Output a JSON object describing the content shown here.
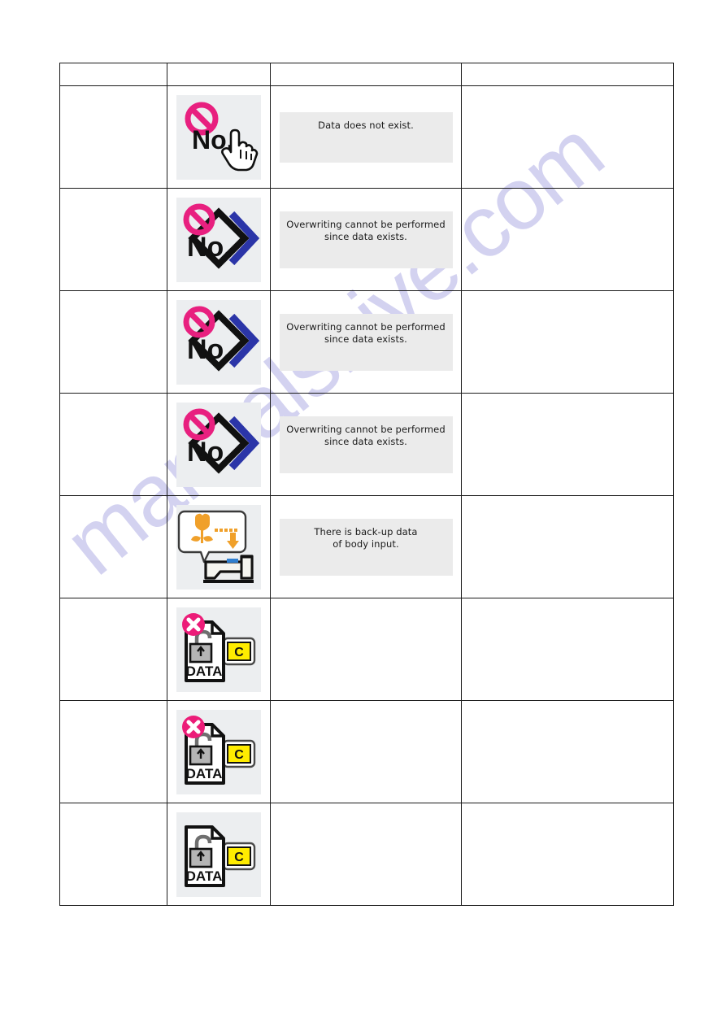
{
  "page": {
    "watermark": "manualshive.com",
    "background_color": "#ffffff",
    "watermark_color": "#b9b7e8"
  },
  "table": {
    "border_color": "#1b1b1b",
    "icon_tile_color": "#eceef0",
    "message_panel_color": "#ebebeb",
    "header": {
      "columns": [
        "",
        "",
        "",
        ""
      ]
    },
    "rows": [
      {
        "code": "",
        "icon_name": "no-data-hand-pointer-icon",
        "icon_description": "Pink prohibition circle over the text No. with a pointing hand cursor",
        "message": "Data does not exist.",
        "description": ""
      },
      {
        "code": "",
        "icon_name": "no-overwrite-diamond-icon",
        "icon_description": "Pink prohibition circle over the text No. with black diamond and blue chevron",
        "message": "Overwriting cannot be performed\nsince data exists.",
        "description": ""
      },
      {
        "code": "",
        "icon_name": "no-overwrite-diamond-icon",
        "icon_description": "Pink prohibition circle over the text No. with black diamond and blue chevron",
        "message": "Overwriting cannot be performed\nsince data exists.",
        "description": ""
      },
      {
        "code": "",
        "icon_name": "no-overwrite-diamond-icon",
        "icon_description": "Pink prohibition circle over the text No. with black diamond and blue chevron",
        "message": "Overwriting cannot be performed\nsince data exists.",
        "description": ""
      },
      {
        "code": "",
        "icon_name": "sewing-machine-backup-data-icon",
        "icon_description": "Sewing machine with speech balloon containing orange tulip pattern and download arrow",
        "message": "There is back-up data\nof body input.",
        "description": ""
      },
      {
        "code": "",
        "icon_name": "data-lock-media-error-icon",
        "icon_description": "DATA file with open padlock and pink X badge, yellow C memory card",
        "message": "",
        "description": ""
      },
      {
        "code": "",
        "icon_name": "data-lock-media-error-icon",
        "icon_description": "DATA file with open padlock and pink X badge, yellow C memory card",
        "message": "",
        "description": ""
      },
      {
        "code": "",
        "icon_name": "data-lock-media-icon",
        "icon_description": "DATA file with open padlock and yellow C memory card",
        "message": "",
        "description": ""
      }
    ]
  },
  "icon_labels": {
    "no_text": "No.",
    "data_text": "DATA",
    "card_letter": "C"
  },
  "colors": {
    "prohibition_pink": "#e8207f",
    "badge_pink": "#ec1c78",
    "diamond_blue": "#2b35a8",
    "diamond_black": "#111111",
    "tulip_orange": "#f0a02a",
    "card_yellow": "#ffec00",
    "machine_blue": "#2f7fd0",
    "lock_gray": "#b5b5b5"
  }
}
